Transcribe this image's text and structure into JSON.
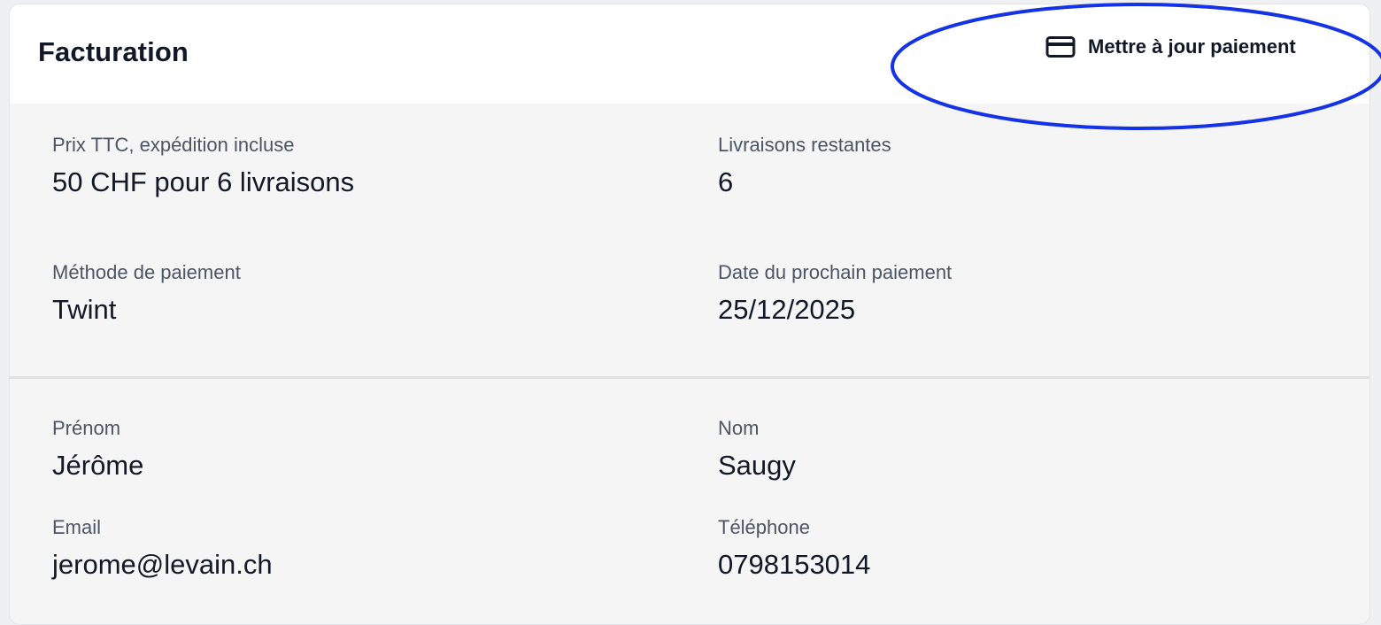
{
  "billing": {
    "title": "Facturation",
    "update_payment_label": "Mettre à jour paiement",
    "update_payment_icon": "credit-card-icon",
    "fields": {
      "price": {
        "label": "Prix TTC, expédition incluse",
        "value": "50 CHF pour 6 livraisons"
      },
      "remaining": {
        "label": "Livraisons restantes",
        "value": "6"
      },
      "method": {
        "label": "Méthode de paiement",
        "value": "Twint"
      },
      "next_payment": {
        "label": "Date du prochain paiement",
        "value": "25/12/2025"
      }
    }
  },
  "contact": {
    "fields": {
      "first_name": {
        "label": "Prénom",
        "value": "Jérôme"
      },
      "last_name": {
        "label": "Nom",
        "value": "Saugy"
      },
      "email": {
        "label": "Email",
        "value": "jerome@levain.ch"
      },
      "phone": {
        "label": "Téléphone",
        "value": "0798153014"
      }
    }
  },
  "colors": {
    "annotation_stroke": "#1432e6",
    "header_bg": "#ffffff",
    "body_bg": "#f5f5f6"
  }
}
